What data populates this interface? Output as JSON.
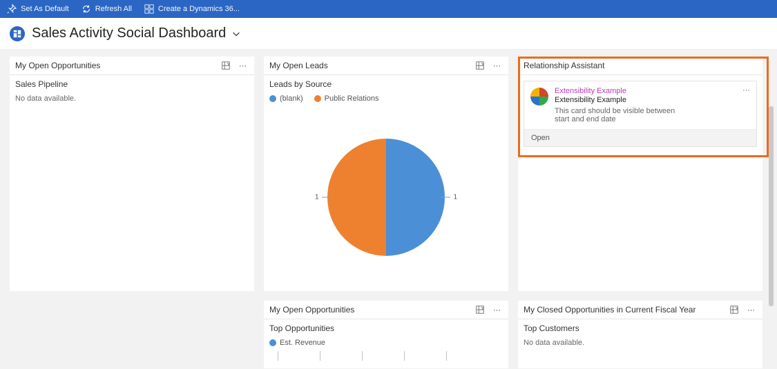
{
  "colors": {
    "brand": "#2b66c4",
    "highlight": "#ec6b1c",
    "series_blank": "#4b8fd6",
    "series_pr": "#ee8130"
  },
  "commandbar": {
    "set_default": "Set As Default",
    "refresh_all": "Refresh All",
    "create_template": "Create a Dynamics 36..."
  },
  "page_title": "Sales Activity Social Dashboard",
  "panels": {
    "opportunities": {
      "title": "My Open Opportunities",
      "sub": "Sales Pipeline",
      "nodata": "No data available."
    },
    "leads": {
      "title": "My Open Leads",
      "sub": "Leads by Source",
      "legend": {
        "blank": "(blank)",
        "pr": "Public Relations"
      }
    },
    "relassist": {
      "title": "Relationship Assistant",
      "card": {
        "link": "Extensibility Example",
        "sub": "Extensibility Example",
        "body": "This card should be visible between start and end date",
        "open": "Open"
      }
    },
    "open_opps2": {
      "title": "My Open Opportunities",
      "sub": "Top Opportunities",
      "legend": "Est. Revenue"
    },
    "closed_opps": {
      "title": "My Closed Opportunities in Current Fiscal Year",
      "sub": "Top Customers",
      "nodata": "No data available."
    }
  },
  "chart_data": {
    "type": "pie",
    "title": "Leads by Source",
    "series": [
      {
        "name": "(blank)",
        "value": 1,
        "color": "#ee8130"
      },
      {
        "name": "Public Relations",
        "value": 1,
        "color": "#4b8fd6"
      }
    ],
    "labels": {
      "left": "1",
      "right": "1"
    }
  }
}
